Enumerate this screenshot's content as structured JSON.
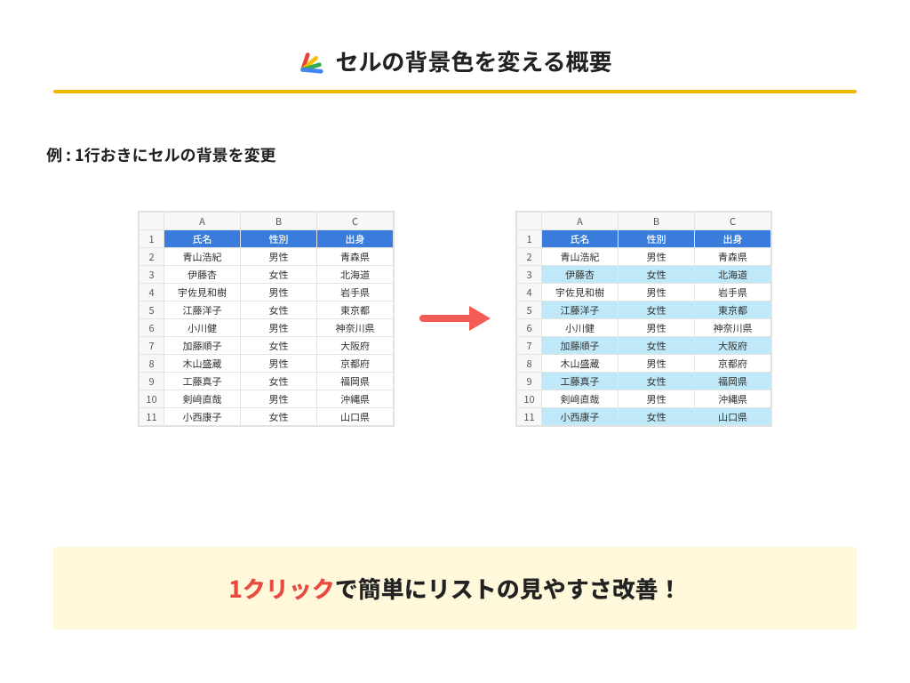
{
  "title": "セルの背景色を変える概要",
  "subtitle": "例 : 1行おきにセルの背景を変更",
  "columns": [
    "A",
    "B",
    "C"
  ],
  "headers": [
    "氏名",
    "性別",
    "出身"
  ],
  "rows": [
    [
      "青山浩紀",
      "男性",
      "青森県"
    ],
    [
      "伊藤杏",
      "女性",
      "北海道"
    ],
    [
      "宇佐見和樹",
      "男性",
      "岩手県"
    ],
    [
      "江藤洋子",
      "女性",
      "東京都"
    ],
    [
      "小川健",
      "男性",
      "神奈川県"
    ],
    [
      "加藤順子",
      "女性",
      "大阪府"
    ],
    [
      "木山盛蔵",
      "男性",
      "京都府"
    ],
    [
      "工藤真子",
      "女性",
      "福岡県"
    ],
    [
      "剣﨑直哉",
      "男性",
      "沖縄県"
    ],
    [
      "小西康子",
      "女性",
      "山口県"
    ]
  ],
  "banner_em": "1クリック",
  "banner_rest": "で簡単にリストの見やすさ改善！",
  "arrow": "→"
}
